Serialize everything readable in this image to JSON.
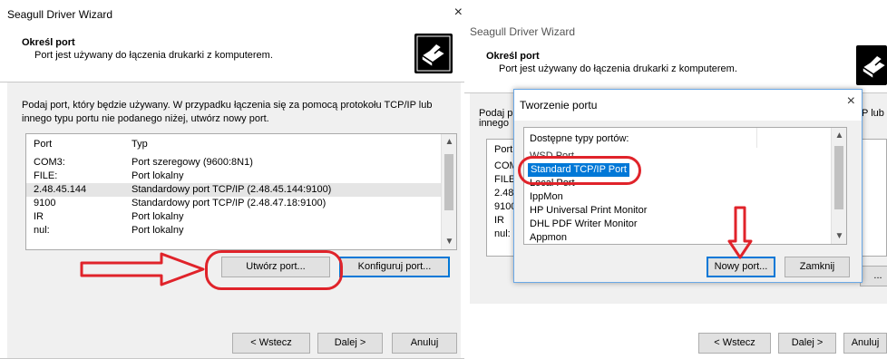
{
  "left_window": {
    "title": "Seagull Driver Wizard",
    "close": "×",
    "header_title": "Określ port",
    "header_subtitle": "Port jest używany do łączenia drukarki z komputerem.",
    "intro_line1": "Podaj port, który będzie używany. W przypadku łączenia się za pomocą protokołu TCP/IP lub",
    "intro_line2": "innego typu portu nie podanego niżej, utwórz nowy port.",
    "columns": [
      "Port",
      "Typ"
    ],
    "rows": [
      {
        "port": "COM3:",
        "type": "Port szeregowy (9600:8N1)"
      },
      {
        "port": "FILE:",
        "type": "Port lokalny"
      },
      {
        "port": "2.48.45.144",
        "type": "Standardowy port TCP/IP (2.48.45.144:9100)"
      },
      {
        "port": "9100",
        "type": "Standardowy port TCP/IP (2.48.47.18:9100)"
      },
      {
        "port": "IR",
        "type": "Port lokalny"
      },
      {
        "port": "nul:",
        "type": "Port lokalny"
      }
    ],
    "create_port": "Utwórz port...",
    "configure_port": "Konfiguruj port...",
    "back": "< Wstecz",
    "next": "Dalej >",
    "cancel": "Anuluj"
  },
  "right_window": {
    "title": "Seagull Driver Wizard",
    "header_title": "Określ port",
    "header_subtitle": "Port jest używany do łączenia drukarki z komputerem.",
    "intro_fragment1": "Podaj p",
    "intro_fragment2": "innego",
    "intro_tail": "P lub",
    "col_port": "Port",
    "rows_fragment": [
      "COM",
      "FILE:",
      "2.48",
      "9100",
      "IR",
      "nul:"
    ],
    "configure_fragment": "...",
    "back": "< Wstecz",
    "next": "Dalej >",
    "cancel": "Anuluj"
  },
  "dialog": {
    "title": "Tworzenie portu",
    "close": "×",
    "list_header": "Dostępne typy portów:",
    "items": [
      "WSD Port",
      "Standard TCP/IP Port",
      "Local Port",
      "IppMon",
      "HP Universal Print Monitor",
      "DHL PDF Writer Monitor",
      "Appmon"
    ],
    "selected_index": 1,
    "new_port": "Nowy port...",
    "close_button": "Zamknij"
  },
  "colors": {
    "annotation_red": "#e0232a",
    "selection_blue": "#0078d7",
    "dialog_border": "#6aa8e6"
  },
  "icons": [
    "printer-icon",
    "close-icon",
    "chevron-up-icon",
    "chevron-down-icon",
    "arrow-right-icon",
    "arrow-down-icon"
  ]
}
